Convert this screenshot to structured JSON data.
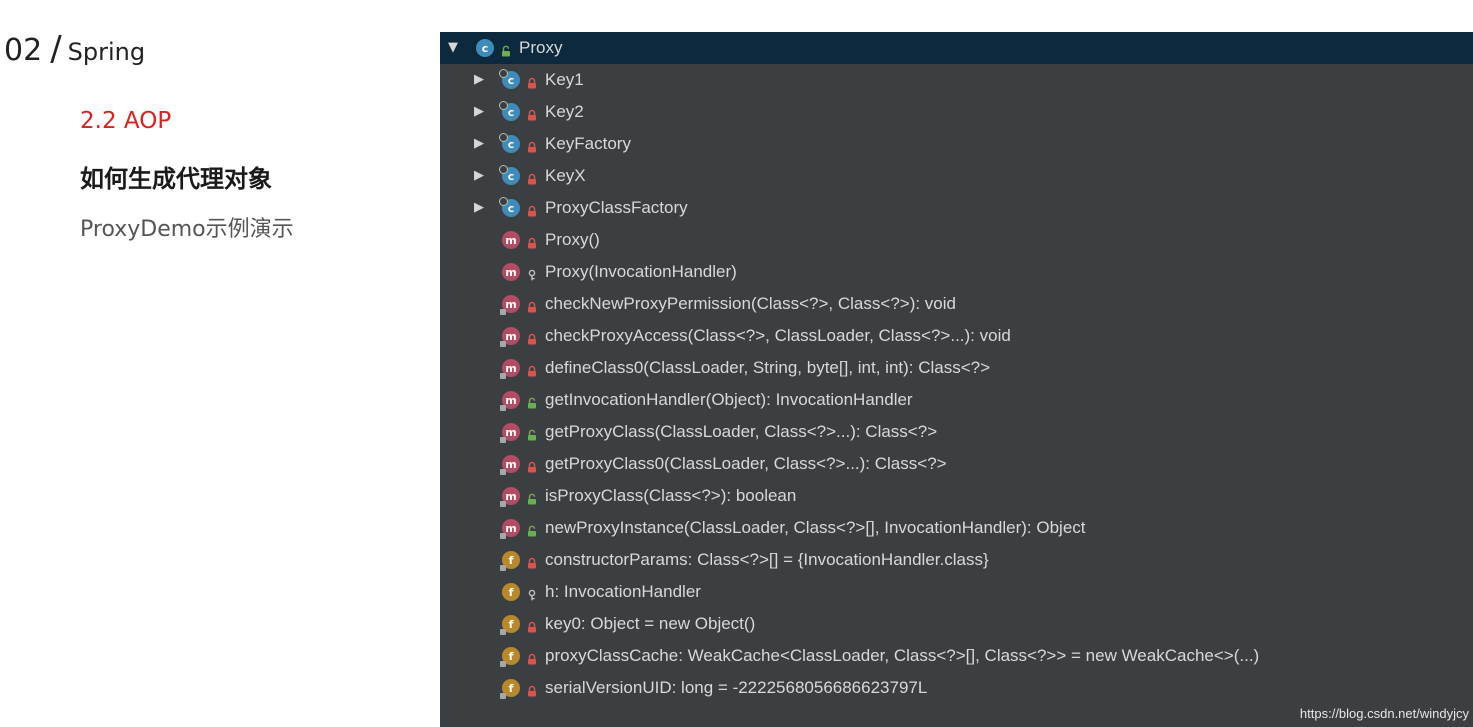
{
  "slide": {
    "number": "02",
    "slash": "/",
    "name": "Spring",
    "section": "2.2 AOP",
    "heading": "如何生成代理对象",
    "demo": "ProxyDemo示例演示"
  },
  "structure": {
    "root": {
      "label": "Proxy",
      "icon": "class-icon",
      "visibility": "public",
      "expanded": true
    },
    "items": [
      {
        "label": "Key1",
        "icon": "class-icon",
        "visibility": "private",
        "expandable": true
      },
      {
        "label": "Key2",
        "icon": "class-icon",
        "visibility": "private",
        "expandable": true
      },
      {
        "label": "KeyFactory",
        "icon": "class-icon",
        "visibility": "private",
        "expandable": true
      },
      {
        "label": "KeyX",
        "icon": "class-icon",
        "visibility": "private",
        "expandable": true
      },
      {
        "label": "ProxyClassFactory",
        "icon": "class-icon",
        "visibility": "private",
        "expandable": true
      },
      {
        "label": "Proxy()",
        "icon": "method-icon",
        "visibility": "private",
        "static": false
      },
      {
        "label": "Proxy(InvocationHandler)",
        "icon": "method-icon",
        "visibility": "protected",
        "static": false
      },
      {
        "label": "checkNewProxyPermission(Class<?>, Class<?>): void",
        "icon": "method-icon",
        "visibility": "private",
        "static": true
      },
      {
        "label": "checkProxyAccess(Class<?>, ClassLoader, Class<?>...): void",
        "icon": "method-icon",
        "visibility": "private",
        "static": true
      },
      {
        "label": "defineClass0(ClassLoader, String, byte[], int, int): Class<?>",
        "icon": "method-icon",
        "visibility": "private",
        "static": true
      },
      {
        "label": "getInvocationHandler(Object): InvocationHandler",
        "icon": "method-icon",
        "visibility": "public",
        "static": true
      },
      {
        "label": "getProxyClass(ClassLoader, Class<?>...): Class<?>",
        "icon": "method-icon",
        "visibility": "public",
        "static": true
      },
      {
        "label": "getProxyClass0(ClassLoader, Class<?>...): Class<?>",
        "icon": "method-icon",
        "visibility": "private",
        "static": true
      },
      {
        "label": "isProxyClass(Class<?>): boolean",
        "icon": "method-icon",
        "visibility": "public",
        "static": true
      },
      {
        "label": "newProxyInstance(ClassLoader, Class<?>[], InvocationHandler): Object",
        "icon": "method-icon",
        "visibility": "public",
        "static": true
      },
      {
        "label": "constructorParams: Class<?>[] = {InvocationHandler.class}",
        "icon": "field-icon",
        "visibility": "private",
        "static": true
      },
      {
        "label": "h: InvocationHandler",
        "icon": "field-icon",
        "visibility": "protected",
        "static": false
      },
      {
        "label": "key0: Object = new Object()",
        "icon": "field-icon",
        "visibility": "private",
        "static": true
      },
      {
        "label": "proxyClassCache: WeakCache<ClassLoader, Class<?>[], Class<?>> = new WeakCache<>(...)",
        "icon": "field-icon",
        "visibility": "private",
        "static": true
      },
      {
        "label": "serialVersionUID: long = -2222568056686623797L",
        "icon": "field-icon",
        "visibility": "private",
        "static": true
      }
    ]
  },
  "watermark": "https://blog.csdn.net/windyjcy",
  "colors": {
    "panel_bg": "#3c3f41",
    "selected_bg": "#0d293e",
    "class": "#3f8cb8",
    "method": "#b24d61",
    "field": "#b8892c",
    "private_lock": "#d9534f",
    "public_lock": "#6aaf50",
    "section_red": "#e0201c"
  }
}
